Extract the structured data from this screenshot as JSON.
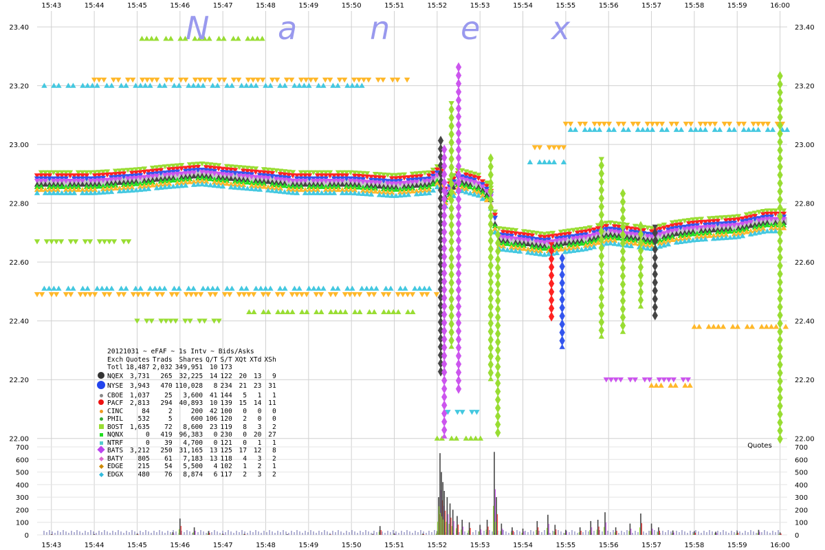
{
  "watermark": [
    "N",
    "a",
    "n",
    "e",
    "x"
  ],
  "chart_data": {
    "type": "scatter",
    "title": "20121031 ~ eFAF ~ 1s Intv ~ Bids/Asks",
    "x_ticks": [
      "15:43",
      "15:44",
      "15:45",
      "15:46",
      "15:47",
      "15:48",
      "15:49",
      "15:50",
      "15:51",
      "15:52",
      "15:53",
      "15:54",
      "15:55",
      "15:56",
      "15:57",
      "15:58",
      "15:59",
      "16:00"
    ],
    "x_range": [
      "15:42:40",
      "16:00:10"
    ],
    "price_axis": {
      "ticks": [
        "22.00",
        "22.20",
        "22.40",
        "22.60",
        "22.80",
        "23.00",
        "23.20",
        "23.40"
      ],
      "range": [
        21.99,
        23.44
      ]
    },
    "volume_axis": {
      "label": "Quotes",
      "ticks": [
        0,
        100,
        200,
        300,
        400,
        500,
        600,
        700
      ],
      "range": [
        0,
        700
      ]
    },
    "grid": true,
    "nbbo_midprice_series": [
      [
        "15:42:40",
        22.87
      ],
      [
        "15:44:00",
        22.87
      ],
      [
        "15:45:00",
        22.88
      ],
      [
        "15:45:40",
        22.89
      ],
      [
        "15:46:30",
        22.9
      ],
      [
        "15:47:10",
        22.89
      ],
      [
        "15:48:00",
        22.88
      ],
      [
        "15:48:40",
        22.87
      ],
      [
        "15:50:00",
        22.87
      ],
      [
        "15:51:00",
        22.86
      ],
      [
        "15:51:50",
        22.87
      ],
      [
        "15:52:05",
        22.9
      ],
      [
        "15:52:10",
        22.82
      ],
      [
        "15:52:30",
        22.88
      ],
      [
        "15:53:00",
        22.86
      ],
      [
        "15:53:15",
        22.82
      ],
      [
        "15:53:25",
        22.68
      ],
      [
        "15:54:00",
        22.67
      ],
      [
        "15:54:30",
        22.66
      ],
      [
        "15:55:00",
        22.67
      ],
      [
        "15:55:30",
        22.68
      ],
      [
        "15:56:00",
        22.7
      ],
      [
        "15:56:30",
        22.69
      ],
      [
        "15:57:00",
        22.68
      ],
      [
        "15:57:30",
        22.7
      ],
      [
        "15:58:00",
        22.71
      ],
      [
        "15:59:00",
        22.72
      ],
      [
        "15:59:40",
        22.74
      ],
      [
        "16:00:10",
        22.74
      ]
    ],
    "outlier_quote_bands": [
      {
        "price": 23.36,
        "from": "15:45:00",
        "to": "15:48:00",
        "color": "#99dd33"
      },
      {
        "price": 23.22,
        "from": "15:44:00",
        "to": "15:51:20",
        "color": "#ffb82a"
      },
      {
        "price": 23.2,
        "from": "15:42:50",
        "to": "15:50:20",
        "color": "#44c8e0"
      },
      {
        "price": 23.07,
        "from": "15:55:00",
        "to": "16:00:10",
        "color": "#ffb82a"
      },
      {
        "price": 23.05,
        "from": "15:55:00",
        "to": "16:00:10",
        "color": "#44c8e0"
      },
      {
        "price": 22.67,
        "from": "15:42:40",
        "to": "15:45:00",
        "color": "#99dd33"
      },
      {
        "price": 22.51,
        "from": "15:42:50",
        "to": "15:52:00",
        "color": "#44c8e0"
      },
      {
        "price": 22.49,
        "from": "15:42:40",
        "to": "15:52:00",
        "color": "#ffb82a"
      },
      {
        "price": 22.43,
        "from": "15:47:30",
        "to": "15:51:30",
        "color": "#99dd33"
      },
      {
        "price": 22.4,
        "from": "15:45:00",
        "to": "15:47:00",
        "color": "#99dd33"
      },
      {
        "price": 22.38,
        "from": "15:58:00",
        "to": "16:00:10",
        "color": "#ffb82a"
      },
      {
        "price": 22.2,
        "from": "15:55:50",
        "to": "15:58:00",
        "color": "#cc55ee"
      },
      {
        "price": 22.18,
        "from": "15:57:00",
        "to": "15:58:00",
        "color": "#ffb82a"
      },
      {
        "price": 22.09,
        "from": "15:52:15",
        "to": "15:53:00",
        "color": "#44c8e0"
      },
      {
        "price": 22.0,
        "from": "15:52:00",
        "to": "15:53:10",
        "color": "#99dd33"
      },
      {
        "price": 22.99,
        "from": "15:54:10",
        "to": "15:55:00",
        "color": "#ffb82a"
      },
      {
        "price": 22.94,
        "from": "15:54:10",
        "to": "15:55:00",
        "color": "#44c8e0"
      }
    ],
    "quote_spikes": [
      {
        "time": "15:52:05",
        "low": 22.22,
        "high": 23.02,
        "color": "#444444"
      },
      {
        "time": "15:52:10",
        "low": 22.0,
        "high": 22.99,
        "color": "#cc55ee"
      },
      {
        "time": "15:52:20",
        "low": 22.3,
        "high": 23.14,
        "color": "#99dd33"
      },
      {
        "time": "15:52:30",
        "low": 22.15,
        "high": 23.27,
        "color": "#cc55ee"
      },
      {
        "time": "15:53:15",
        "low": 22.2,
        "high": 22.96,
        "color": "#444444"
      },
      {
        "time": "15:53:25",
        "low": 22.0,
        "high": 22.7,
        "color": "#99dd33"
      },
      {
        "time": "15:54:40",
        "low": 22.4,
        "high": 22.66,
        "color": "#ff2222"
      },
      {
        "time": "15:54:55",
        "low": 22.3,
        "high": 22.62,
        "color": "#3355ee"
      },
      {
        "time": "15:55:50",
        "low": 22.34,
        "high": 22.95,
        "color": "#cc55ee"
      },
      {
        "time": "15:56:20",
        "low": 22.35,
        "high": 22.84,
        "color": "#3355ee"
      },
      {
        "time": "15:56:45",
        "low": 22.44,
        "high": 22.73,
        "color": "#ff2222"
      },
      {
        "time": "15:57:05",
        "low": 22.4,
        "high": 22.72,
        "color": "#444444"
      },
      {
        "time": "16:00:00",
        "low": 21.99,
        "high": 23.24,
        "color": "#444444"
      }
    ],
    "quote_volume": [
      [
        "15:43:00",
        5
      ],
      [
        "15:44:00",
        6
      ],
      [
        "15:45:00",
        8
      ],
      [
        "15:45:50",
        22
      ],
      [
        "15:46:00",
        130
      ],
      [
        "15:46:20",
        60
      ],
      [
        "15:46:40",
        30
      ],
      [
        "15:47:00",
        10
      ],
      [
        "15:47:30",
        8
      ],
      [
        "15:48:30",
        6
      ],
      [
        "15:49:30",
        5
      ],
      [
        "15:50:30",
        8
      ],
      [
        "15:50:40",
        70
      ],
      [
        "15:51:00",
        12
      ],
      [
        "15:51:40",
        10
      ],
      [
        "15:52:00",
        30
      ],
      [
        "15:52:02",
        300
      ],
      [
        "15:52:04",
        650
      ],
      [
        "15:52:06",
        500
      ],
      [
        "15:52:08",
        420
      ],
      [
        "15:52:10",
        350
      ],
      [
        "15:52:14",
        300
      ],
      [
        "15:52:18",
        250
      ],
      [
        "15:52:22",
        200
      ],
      [
        "15:52:28",
        150
      ],
      [
        "15:52:35",
        120
      ],
      [
        "15:52:45",
        100
      ],
      [
        "15:53:00",
        80
      ],
      [
        "15:53:10",
        120
      ],
      [
        "15:53:20",
        660
      ],
      [
        "15:53:23",
        300
      ],
      [
        "15:53:30",
        90
      ],
      [
        "15:53:45",
        60
      ],
      [
        "15:54:00",
        50
      ],
      [
        "15:54:20",
        110
      ],
      [
        "15:54:35",
        160
      ],
      [
        "15:54:45",
        80
      ],
      [
        "15:55:00",
        40
      ],
      [
        "15:55:20",
        60
      ],
      [
        "15:55:35",
        110
      ],
      [
        "15:55:45",
        120
      ],
      [
        "15:55:55",
        180
      ],
      [
        "15:56:10",
        60
      ],
      [
        "15:56:30",
        90
      ],
      [
        "15:56:45",
        170
      ],
      [
        "15:57:00",
        90
      ],
      [
        "15:57:10",
        60
      ],
      [
        "15:57:30",
        35
      ],
      [
        "15:58:00",
        30
      ],
      [
        "15:58:30",
        25
      ],
      [
        "15:59:00",
        30
      ],
      [
        "15:59:30",
        40
      ],
      [
        "16:00:00",
        20
      ]
    ],
    "legend_title": "20121031 ~ eFAF ~ 1s Intv ~ Bids/Asks",
    "legend_columns": [
      "Exch",
      "Quotes",
      "Trads",
      "Shares",
      "Q/T",
      "S/T",
      "XQt",
      "XTd",
      "XSh"
    ],
    "legend_rows": [
      {
        "exch": "Totl",
        "quotes": "18,487",
        "trads": "2,032",
        "shares": "349,951",
        "qt": "10",
        "st": "173",
        "xqt": "",
        "xtd": "",
        "xsh": "",
        "symbol": "none",
        "color": ""
      },
      {
        "exch": "NQEX",
        "quotes": "3,731",
        "trads": "265",
        "shares": "32,225",
        "qt": "14",
        "st": "122",
        "xqt": "20",
        "xtd": "13",
        "xsh": "9",
        "symbol": "circle-lg",
        "color": "#333333"
      },
      {
        "exch": "NYSE",
        "quotes": "3,943",
        "trads": "470",
        "shares": "110,028",
        "qt": "8",
        "st": "234",
        "xqt": "21",
        "xtd": "23",
        "xsh": "31",
        "symbol": "circle-xl",
        "color": "#2244ee"
      },
      {
        "exch": "CBOE",
        "quotes": "1,037",
        "trads": "25",
        "shares": "3,600",
        "qt": "41",
        "st": "144",
        "xqt": "5",
        "xtd": "1",
        "xsh": "1",
        "symbol": "circle-sm",
        "color": "#888888"
      },
      {
        "exch": "PACF",
        "quotes": "2,813",
        "trads": "294",
        "shares": "40,893",
        "qt": "10",
        "st": "139",
        "xqt": "15",
        "xtd": "14",
        "xsh": "11",
        "symbol": "circle-md",
        "color": "#ee1111"
      },
      {
        "exch": "CINC",
        "quotes": "84",
        "trads": "2",
        "shares": "200",
        "qt": "42",
        "st": "100",
        "xqt": "0",
        "xtd": "0",
        "xsh": "0",
        "symbol": "circle-sm",
        "color": "#ee9922"
      },
      {
        "exch": "PHIL",
        "quotes": "532",
        "trads": "5",
        "shares": "600",
        "qt": "106",
        "st": "120",
        "xqt": "2",
        "xtd": "0",
        "xsh": "0",
        "symbol": "circle-sm",
        "color": "#33aa33"
      },
      {
        "exch": "BOST",
        "quotes": "1,635",
        "trads": "72",
        "shares": "8,600",
        "qt": "23",
        "st": "119",
        "xqt": "8",
        "xtd": "3",
        "xsh": "2",
        "symbol": "square",
        "color": "#99dd33"
      },
      {
        "exch": "NQNX",
        "quotes": "0",
        "trads": "419",
        "shares": "96,383",
        "qt": "0",
        "st": "230",
        "xqt": "0",
        "xtd": "20",
        "xsh": "27",
        "symbol": "square-sm",
        "color": "#22dd22"
      },
      {
        "exch": "NTRF",
        "quotes": "0",
        "trads": "39",
        "shares": "4,700",
        "qt": "0",
        "st": "121",
        "xqt": "0",
        "xtd": "1",
        "xsh": "1",
        "symbol": "square-sm",
        "color": "#55cccc"
      },
      {
        "exch": "BATS",
        "quotes": "3,212",
        "trads": "250",
        "shares": "31,165",
        "qt": "13",
        "st": "125",
        "xqt": "17",
        "xtd": "12",
        "xsh": "8",
        "symbol": "diamond-lg",
        "color": "#bb44ee"
      },
      {
        "exch": "BATY",
        "quotes": "805",
        "trads": "61",
        "shares": "7,183",
        "qt": "13",
        "st": "118",
        "xqt": "4",
        "xtd": "3",
        "xsh": "2",
        "symbol": "diamond-sm",
        "color": "#dd66cc"
      },
      {
        "exch": "EDGE",
        "quotes": "215",
        "trads": "54",
        "shares": "5,500",
        "qt": "4",
        "st": "102",
        "xqt": "1",
        "xtd": "2",
        "xsh": "1",
        "symbol": "diamond-sm",
        "color": "#cc8800"
      },
      {
        "exch": "EDGX",
        "quotes": "480",
        "trads": "76",
        "shares": "8,874",
        "qt": "6",
        "st": "117",
        "xqt": "2",
        "xtd": "3",
        "xsh": "2",
        "symbol": "diamond-sm",
        "color": "#33bbdd"
      }
    ]
  }
}
